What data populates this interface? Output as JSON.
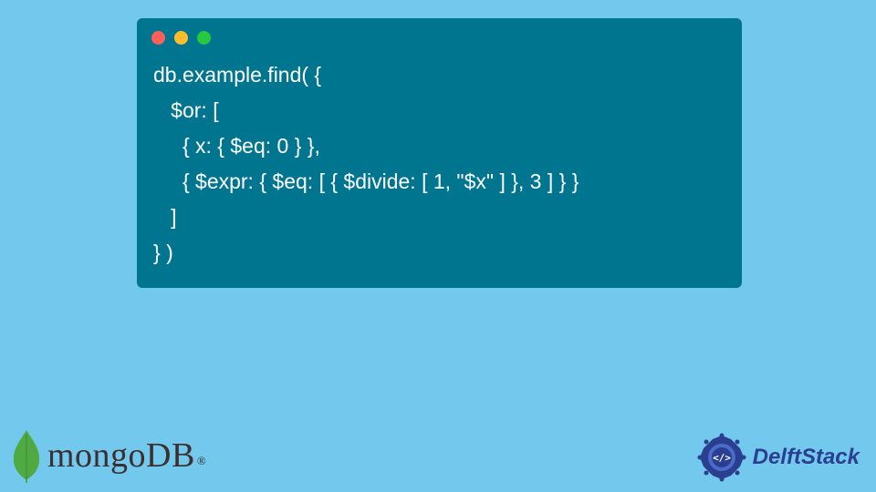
{
  "code": {
    "lines": [
      "db.example.find( {",
      "   $or: [",
      "     { x: { $eq: 0 } },",
      "     { $expr: { $eq: [ { $divide: [ 1, \"$x\" ] }, 3 ] } }",
      "   ]",
      "} )"
    ]
  },
  "logos": {
    "mongo": "mongoDB",
    "mongo_reg": "®",
    "delft": "DelftStack"
  },
  "colors": {
    "page_bg": "#72c9ed",
    "window_bg": "#00758f",
    "dot_red": "#ff5f56",
    "dot_yellow": "#ffbd2e",
    "dot_green": "#27c93f",
    "mongo_leaf": "#4faa41",
    "delft_accent": "#2a3f8f"
  }
}
